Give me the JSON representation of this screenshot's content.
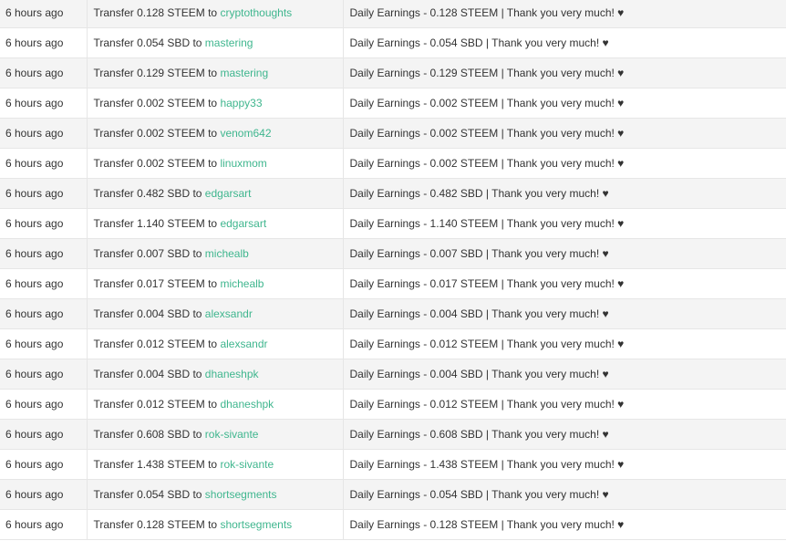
{
  "rows": [
    {
      "time": "6 hours ago",
      "op_prefix": "Transfer 0.128 STEEM to",
      "user": "cryptothoughts",
      "memo": "Daily Earnings - 0.128 STEEM | Thank you very much! ♥"
    },
    {
      "time": "6 hours ago",
      "op_prefix": "Transfer 0.054 SBD to",
      "user": "mastering",
      "memo": "Daily Earnings - 0.054 SBD | Thank you very much! ♥"
    },
    {
      "time": "6 hours ago",
      "op_prefix": "Transfer 0.129 STEEM to",
      "user": "mastering",
      "memo": "Daily Earnings - 0.129 STEEM | Thank you very much! ♥"
    },
    {
      "time": "6 hours ago",
      "op_prefix": "Transfer 0.002 STEEM to",
      "user": "happy33",
      "memo": "Daily Earnings - 0.002 STEEM | Thank you very much! ♥"
    },
    {
      "time": "6 hours ago",
      "op_prefix": "Transfer 0.002 STEEM to",
      "user": "venom642",
      "memo": "Daily Earnings - 0.002 STEEM | Thank you very much! ♥"
    },
    {
      "time": "6 hours ago",
      "op_prefix": "Transfer 0.002 STEEM to",
      "user": "linuxmom",
      "memo": "Daily Earnings - 0.002 STEEM | Thank you very much! ♥"
    },
    {
      "time": "6 hours ago",
      "op_prefix": "Transfer 0.482 SBD to",
      "user": "edgarsart",
      "memo": "Daily Earnings - 0.482 SBD | Thank you very much! ♥"
    },
    {
      "time": "6 hours ago",
      "op_prefix": "Transfer 1.140 STEEM to",
      "user": "edgarsart",
      "memo": "Daily Earnings - 1.140 STEEM | Thank you very much! ♥"
    },
    {
      "time": "6 hours ago",
      "op_prefix": "Transfer 0.007 SBD to",
      "user": "michealb",
      "memo": "Daily Earnings - 0.007 SBD | Thank you very much! ♥"
    },
    {
      "time": "6 hours ago",
      "op_prefix": "Transfer 0.017 STEEM to",
      "user": "michealb",
      "memo": "Daily Earnings - 0.017 STEEM | Thank you very much! ♥"
    },
    {
      "time": "6 hours ago",
      "op_prefix": "Transfer 0.004 SBD to",
      "user": "alexsandr",
      "memo": "Daily Earnings - 0.004 SBD | Thank you very much! ♥"
    },
    {
      "time": "6 hours ago",
      "op_prefix": "Transfer 0.012 STEEM to",
      "user": "alexsandr",
      "memo": "Daily Earnings - 0.012 STEEM | Thank you very much! ♥"
    },
    {
      "time": "6 hours ago",
      "op_prefix": "Transfer 0.004 SBD to",
      "user": "dhaneshpk",
      "memo": "Daily Earnings - 0.004 SBD | Thank you very much! ♥"
    },
    {
      "time": "6 hours ago",
      "op_prefix": "Transfer 0.012 STEEM to",
      "user": "dhaneshpk",
      "memo": "Daily Earnings - 0.012 STEEM | Thank you very much! ♥"
    },
    {
      "time": "6 hours ago",
      "op_prefix": "Transfer 0.608 SBD to",
      "user": "rok-sivante",
      "memo": "Daily Earnings - 0.608 SBD | Thank you very much! ♥"
    },
    {
      "time": "6 hours ago",
      "op_prefix": "Transfer 1.438 STEEM to",
      "user": "rok-sivante",
      "memo": "Daily Earnings - 1.438 STEEM | Thank you very much! ♥"
    },
    {
      "time": "6 hours ago",
      "op_prefix": "Transfer 0.054 SBD to",
      "user": "shortsegments",
      "memo": "Daily Earnings - 0.054 SBD | Thank you very much! ♥"
    },
    {
      "time": "6 hours ago",
      "op_prefix": "Transfer 0.128 STEEM to",
      "user": "shortsegments",
      "memo": "Daily Earnings - 0.128 STEEM | Thank you very much! ♥"
    }
  ]
}
